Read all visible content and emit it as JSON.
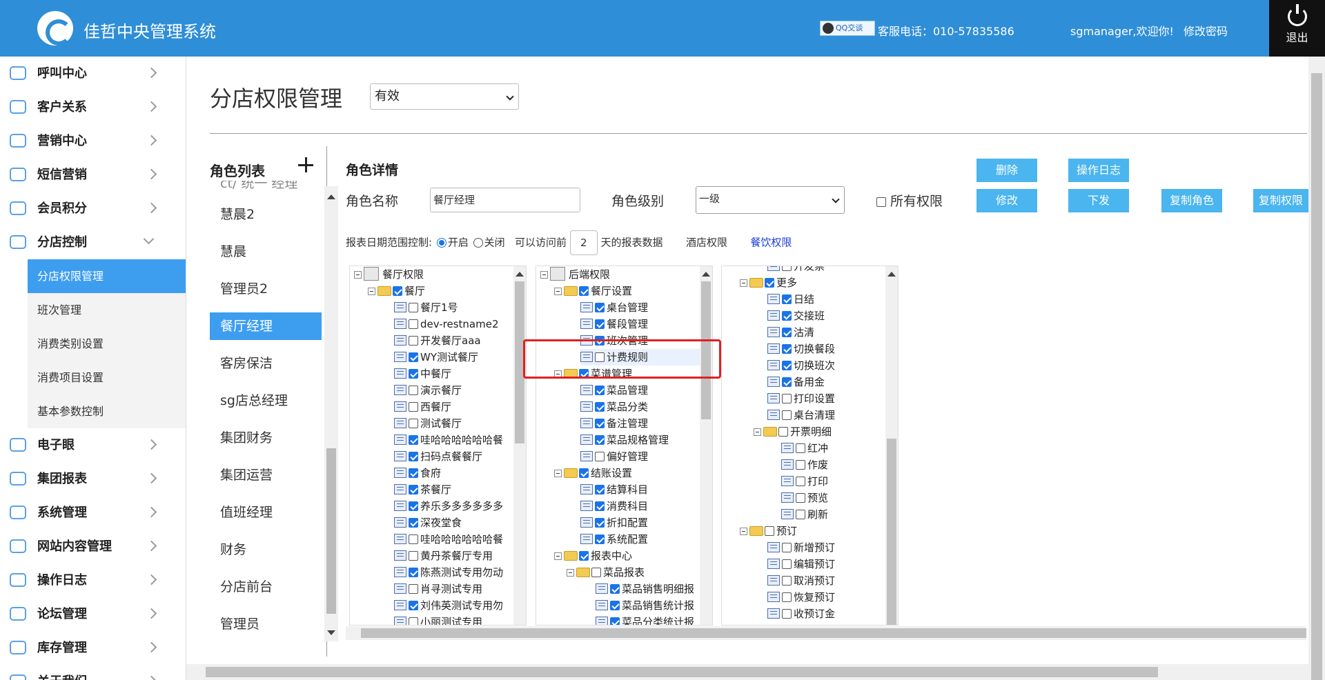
{
  "header": {
    "app_title": "佳哲中央管理系统",
    "qq_label": "QQ交谈",
    "hotline": "客服电话：010-57835586",
    "welcome": "sgmanager,欢迎你!",
    "change_password": "修改密码",
    "logout": "退出",
    "accent_color": "#2f8ed8"
  },
  "sidebar": {
    "items": [
      {
        "label": "呼叫中心",
        "icon": "headset-icon"
      },
      {
        "label": "客户关系",
        "icon": "trophy-icon"
      },
      {
        "label": "营销中心",
        "icon": "umbrella-icon"
      },
      {
        "label": "短信营销",
        "icon": "mail-icon"
      },
      {
        "label": "会员积分",
        "icon": "diamond-icon"
      },
      {
        "label": "分店控制",
        "icon": "store-icon"
      }
    ],
    "sub_items": [
      "分店权限管理",
      "班次管理",
      "消费类别设置",
      "消费项目设置",
      "基本参数控制"
    ],
    "items_after": [
      {
        "label": "电子眼",
        "icon": "camera-icon"
      },
      {
        "label": "集团报表",
        "icon": "chart-icon"
      },
      {
        "label": "系统管理",
        "icon": "settings-icon"
      },
      {
        "label": "网站内容管理",
        "icon": "grid-icon"
      },
      {
        "label": "操作日志",
        "icon": "edit-icon"
      },
      {
        "label": "论坛管理",
        "icon": "atom-icon"
      },
      {
        "label": "库存管理",
        "icon": "inbox-icon"
      },
      {
        "label": "关于我们",
        "icon": "info-icon"
      }
    ]
  },
  "main": {
    "page_title": "分店权限管理",
    "status_select": "有效",
    "role_list_title": "角色列表",
    "roles": [
      "ct/ 统一 经理",
      "慧晨2",
      "慧晨",
      "管理员2",
      "餐厅经理",
      "客房保洁",
      "sg店总经理",
      "集团财务",
      "集团运营",
      "值班经理",
      "财务",
      "分店前台",
      "管理员"
    ],
    "detail_title": "角色详情",
    "role_name_label": "角色名称",
    "role_name_value": "餐厅经理",
    "role_level_label": "角色级别",
    "role_level_value": "一级",
    "all_perms_label": "所有权限",
    "buttons": {
      "delete": "删除",
      "log": "操作日志",
      "modify": "修改",
      "dispatch": "下发",
      "copy_role": "复制角色",
      "copy_perm": "复制权限"
    },
    "report_range_label": "报表日期范围控制:",
    "radio_on": "开启",
    "radio_off": "关闭",
    "access_prefix": "可以访问前",
    "days_value": "2",
    "access_suffix": "天的报表数据",
    "hotel_perm": "酒店权限",
    "food_perm": "餐饮权限"
  },
  "tree1": {
    "root": "餐厅权限",
    "group": "餐厅",
    "items": [
      {
        "label": "餐厅1号",
        "checked": false
      },
      {
        "label": "dev-restname2",
        "checked": false
      },
      {
        "label": "开发餐厅aaa",
        "checked": false
      },
      {
        "label": "WY测试餐厅",
        "checked": true
      },
      {
        "label": "中餐厅",
        "checked": true
      },
      {
        "label": "演示餐厅",
        "checked": false
      },
      {
        "label": "西餐厅",
        "checked": false
      },
      {
        "label": "测试餐厅",
        "checked": false
      },
      {
        "label": "哇哈哈哈哈哈哈餐",
        "checked": true
      },
      {
        "label": "扫码点餐餐厅",
        "checked": true
      },
      {
        "label": "食府",
        "checked": true
      },
      {
        "label": "茶餐厅",
        "checked": true
      },
      {
        "label": "养乐多多多多多多",
        "checked": true
      },
      {
        "label": "深夜堂食",
        "checked": true
      },
      {
        "label": "哇哈哈哈哈哈哈餐",
        "checked": false
      },
      {
        "label": "黄丹茶餐厅专用",
        "checked": false
      },
      {
        "label": "陈燕测试专用勿动",
        "checked": true
      },
      {
        "label": "肖寻测试专用",
        "checked": false
      },
      {
        "label": "刘伟英测试专用勿",
        "checked": true
      },
      {
        "label": "小丽测试专用",
        "checked": false
      }
    ]
  },
  "tree2": {
    "root": "后端权限",
    "rows": [
      {
        "label": "餐厅设置",
        "level": 1,
        "folder": true,
        "checked": true
      },
      {
        "label": "桌台管理",
        "level": 2,
        "checked": true
      },
      {
        "label": "餐段管理",
        "level": 2,
        "checked": true
      },
      {
        "label": "班次管理",
        "level": 2,
        "checked": true
      },
      {
        "label": "计费规则",
        "level": 2,
        "checked": false
      },
      {
        "label": "菜谱管理",
        "level": 1,
        "folder": true,
        "checked": true
      },
      {
        "label": "菜品管理",
        "level": 2,
        "checked": true
      },
      {
        "label": "菜品分类",
        "level": 2,
        "checked": true
      },
      {
        "label": "备注管理",
        "level": 2,
        "checked": true
      },
      {
        "label": "菜品规格管理",
        "level": 2,
        "checked": true
      },
      {
        "label": "偏好管理",
        "level": 2,
        "checked": false
      },
      {
        "label": "结账设置",
        "level": 1,
        "folder": true,
        "checked": true
      },
      {
        "label": "结算科目",
        "level": 2,
        "checked": true
      },
      {
        "label": "消费科目",
        "level": 2,
        "checked": true
      },
      {
        "label": "折扣配置",
        "level": 2,
        "checked": true
      },
      {
        "label": "系统配置",
        "level": 2,
        "checked": true
      },
      {
        "label": "报表中心",
        "level": 1,
        "folder": true,
        "checked": true
      },
      {
        "label": "菜品报表",
        "level": 2,
        "folder": true,
        "checked": false
      },
      {
        "label": "菜品销售明细报",
        "level": 3,
        "checked": true
      },
      {
        "label": "菜品销售统计报",
        "level": 3,
        "checked": true
      },
      {
        "label": "菜品分类统计报",
        "level": 3,
        "checked": true
      }
    ]
  },
  "tree3": {
    "rows": [
      {
        "label": "开发票",
        "level": 2,
        "checked": false
      },
      {
        "label": "更多",
        "level": 1,
        "folder": true,
        "checked": true
      },
      {
        "label": "日结",
        "level": 2,
        "checked": true
      },
      {
        "label": "交接班",
        "level": 2,
        "checked": true
      },
      {
        "label": "沽清",
        "level": 2,
        "checked": true
      },
      {
        "label": "切换餐段",
        "level": 2,
        "checked": true
      },
      {
        "label": "切换班次",
        "level": 2,
        "checked": true
      },
      {
        "label": "备用金",
        "level": 2,
        "checked": true
      },
      {
        "label": "打印设置",
        "level": 2,
        "checked": false
      },
      {
        "label": "桌台清理",
        "level": 2,
        "checked": false
      },
      {
        "label": "开票明细",
        "level": 2,
        "folder": true,
        "checked": false
      },
      {
        "label": "红冲",
        "level": 3,
        "checked": false
      },
      {
        "label": "作废",
        "level": 3,
        "checked": false
      },
      {
        "label": "打印",
        "level": 3,
        "checked": false
      },
      {
        "label": "预览",
        "level": 3,
        "checked": false
      },
      {
        "label": "刷新",
        "level": 3,
        "checked": false
      },
      {
        "label": "预订",
        "level": 1,
        "folder": true,
        "checked": false
      },
      {
        "label": "新增预订",
        "level": 2,
        "checked": false
      },
      {
        "label": "编辑预订",
        "level": 2,
        "checked": false
      },
      {
        "label": "取消预订",
        "level": 2,
        "checked": false
      },
      {
        "label": "恢复预订",
        "level": 2,
        "checked": false
      },
      {
        "label": "收预订金",
        "level": 2,
        "checked": false
      }
    ]
  }
}
